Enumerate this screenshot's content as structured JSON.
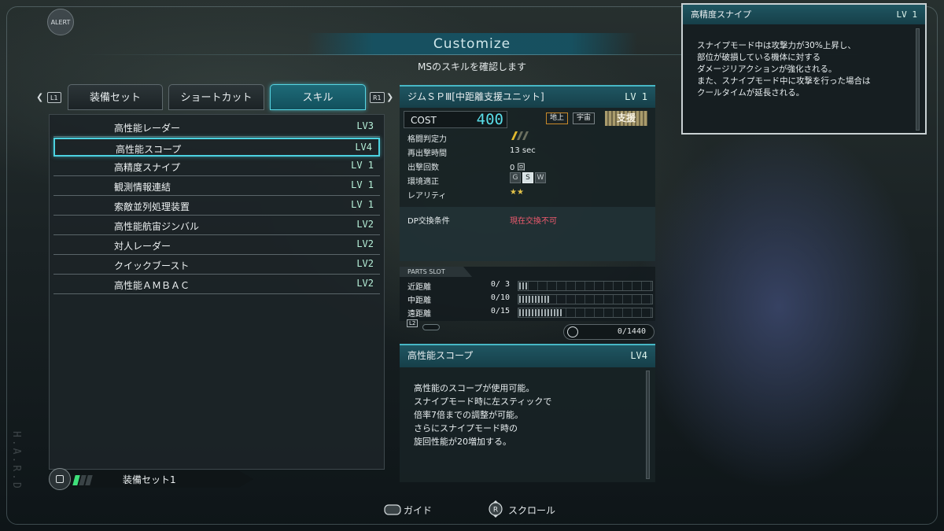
{
  "hud": {
    "alert_label": "ALERT",
    "side_text": "H.A.R.D"
  },
  "header": {
    "title": "Customize",
    "subtitle": "MSのスキルを確認します"
  },
  "tabs": {
    "l1": "L1",
    "r1": "R1",
    "items": [
      {
        "label": "装備セット",
        "active": false
      },
      {
        "label": "ショートカット",
        "active": false
      },
      {
        "label": "スキル",
        "active": true
      }
    ]
  },
  "skills": [
    {
      "name": "高性能レーダー",
      "lv": "LV3"
    },
    {
      "name": "高性能スコープ",
      "lv": "LV4",
      "selected": true
    },
    {
      "name": "高精度スナイプ",
      "lv": "LV 1"
    },
    {
      "name": "観測情報連結",
      "lv": "LV 1"
    },
    {
      "name": "索敵並列処理装置",
      "lv": "LV 1"
    },
    {
      "name": "高性能航宙ジンバル",
      "lv": "LV2"
    },
    {
      "name": "対人レーダー",
      "lv": "LV2"
    },
    {
      "name": "クイックブースト",
      "lv": "LV2"
    },
    {
      "name": "高性能ＡＭＢＡＣ",
      "lv": "LV2"
    }
  ],
  "loadout": {
    "label": "装備セット1"
  },
  "ms": {
    "name": "ジムＳＰⅢ[中距離支援ユニット]",
    "lv": "LV 1",
    "cost_label": "COST",
    "cost": "400",
    "env_ground": "地上",
    "env_space": "宇宙",
    "role": "支援",
    "stats": [
      {
        "label": "格闘判定力",
        "value": ""
      },
      {
        "label": "再出撃時間",
        "value": "13 sec"
      },
      {
        "label": "出撃回数",
        "value": "0 回"
      },
      {
        "label": "環境適正",
        "value": ""
      },
      {
        "label": "レアリティ",
        "value": "★★"
      }
    ],
    "grades": [
      "G",
      "S",
      "W"
    ],
    "dp_label": "DP交換条件",
    "dp_value": "現在交換不可"
  },
  "parts": {
    "title": "PARTS SLOT",
    "rows": [
      {
        "label": "近距離",
        "value": "0/ 3",
        "fill": 0.07
      },
      {
        "label": "中距離",
        "value": "0/10",
        "fill": 0.23
      },
      {
        "label": "遠距離",
        "value": "0/15",
        "fill": 0.33
      }
    ],
    "l2": "L2",
    "counter": "0/1440"
  },
  "detail": {
    "name": "高性能スコープ",
    "lv": "LV4",
    "text": "高性能のスコープが使用可能。\nスナイプモード時に左スティックで\n倍率7倍までの調整が可能。\nさらにスナイプモード時の\n旋回性能が20増加する。"
  },
  "tooltip": {
    "name": "高精度スナイプ",
    "lv": "LV 1",
    "text": "スナイプモード中は攻撃力が30%上昇し、\n部位が破損している機体に対する\nダメージリアクションが強化される。\nまた、スナイプモード中に攻撃を行った場合は\nクールタイムが延長される。"
  },
  "hints": {
    "guide": "ガイド",
    "scroll": "スクロール"
  },
  "colors": {
    "accent": "#4cd2e0",
    "level": "#b6f0d8",
    "cost": "#59dde8",
    "warning": "#ef5a6e",
    "loadout_on": "#3fe07a"
  }
}
